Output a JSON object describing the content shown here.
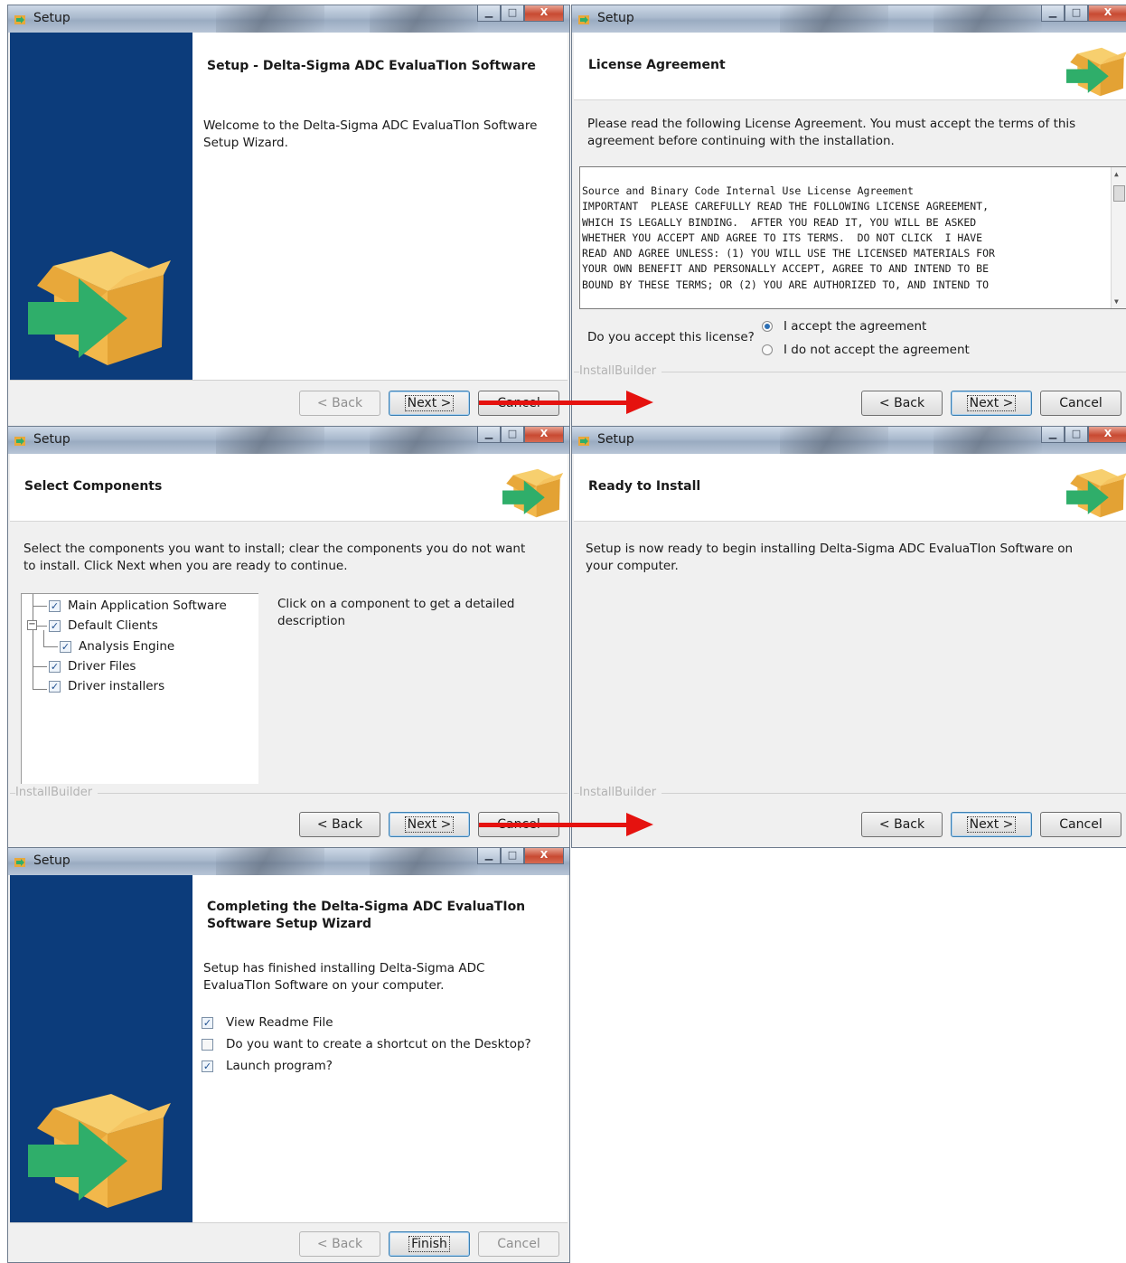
{
  "window_title": "Setup",
  "title_buttons": {
    "minimize": "▁",
    "maximize": "□",
    "close": "X"
  },
  "brand": "InstallBuilder",
  "buttons": {
    "back": "< Back",
    "next": "Next >",
    "cancel": "Cancel",
    "finish": "Finish"
  },
  "welcome": {
    "title": "Setup - Delta-Sigma ADC EvaluaTIon Software",
    "text": "Welcome to the Delta-Sigma ADC EvaluaTIon Software Setup Wizard."
  },
  "license": {
    "title": "License Agreement",
    "intro": "Please read the following License Agreement. You must accept the terms of this agreement before continuing with the installation.",
    "text_lines": [
      "Source and Binary Code Internal Use License Agreement",
      "",
      "IMPORTANT  PLEASE CAREFULLY READ THE FOLLOWING LICENSE AGREEMENT,",
      "WHICH IS LEGALLY BINDING.  AFTER YOU READ IT, YOU WILL BE ASKED",
      "WHETHER YOU ACCEPT AND AGREE TO ITS TERMS.  DO NOT CLICK  I HAVE",
      "READ AND AGREE UNLESS: (1) YOU WILL USE THE LICENSED MATERIALS FOR",
      "YOUR OWN BENEFIT AND PERSONALLY ACCEPT, AGREE TO AND INTEND TO BE",
      "BOUND BY THESE TERMS; OR (2) YOU ARE AUTHORIZED TO, AND INTEND TO"
    ],
    "question": "Do you accept this license?",
    "accept_label": "I accept the agreement",
    "decline_label": "I do not accept the agreement",
    "accepted": true
  },
  "components": {
    "title": "Select Components",
    "intro": "Select the components you want to install; clear the components you do not want to install. Click Next when you are ready to continue.",
    "items": [
      {
        "label": "Main Application Software",
        "checked": true
      },
      {
        "label": "Default Clients",
        "checked": true
      },
      {
        "label": "Analysis Engine",
        "checked": true
      },
      {
        "label": "Driver Files",
        "checked": true
      },
      {
        "label": "Driver installers",
        "checked": true
      }
    ],
    "description": "Click on a component to get a detailed description"
  },
  "ready": {
    "title": "Ready to Install",
    "text": "Setup is now ready to begin installing Delta-Sigma ADC EvaluaTIon Software on your computer."
  },
  "complete": {
    "title": "Completing the Delta-Sigma ADC EvaluaTIon Software Setup Wizard",
    "text": "Setup has finished installing Delta-Sigma ADC EvaluaTIon Software on your computer.",
    "options": [
      {
        "label": "View Readme File",
        "checked": true
      },
      {
        "label": "Do you want to create a shortcut on the Desktop?",
        "checked": false
      },
      {
        "label": "Launch program?",
        "checked": true
      }
    ]
  },
  "colors": {
    "sidebar": "#0c3c7b",
    "arrow": "#e5120f",
    "box": "#f2b84b",
    "box_arrow": "#2fae6a"
  }
}
